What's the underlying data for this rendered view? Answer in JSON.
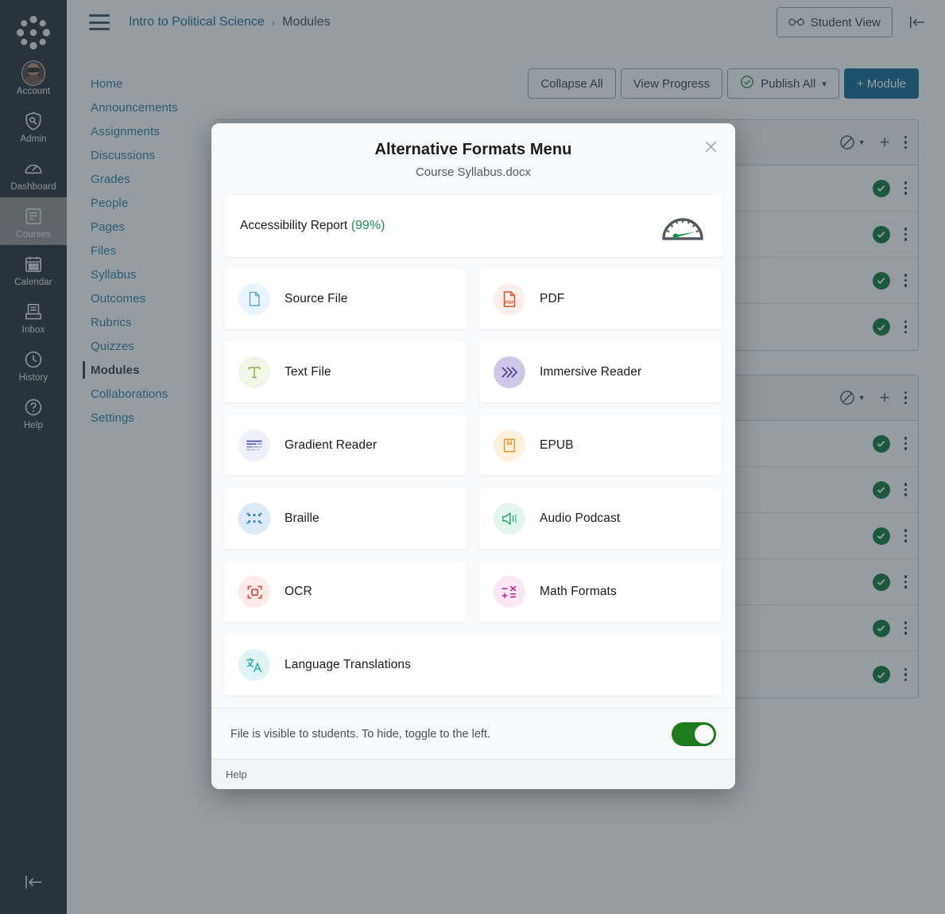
{
  "global_nav": {
    "logo_name": "canvas-logo",
    "items": [
      {
        "label": "Account",
        "icon": "avatar-icon",
        "active": false
      },
      {
        "label": "Admin",
        "icon": "shield-icon",
        "active": false
      },
      {
        "label": "Dashboard",
        "icon": "dashboard-icon",
        "active": false
      },
      {
        "label": "Courses",
        "icon": "courses-icon",
        "active": true
      },
      {
        "label": "Calendar",
        "icon": "calendar-icon",
        "active": false
      },
      {
        "label": "Inbox",
        "icon": "inbox-icon",
        "active": false
      },
      {
        "label": "History",
        "icon": "clock-icon",
        "active": false
      },
      {
        "label": "Help",
        "icon": "question-icon",
        "active": false
      }
    ],
    "collapse_icon": "collapse-left-icon"
  },
  "header": {
    "menu_icon": "hamburger-icon",
    "breadcrumb": {
      "course": "Intro to Political Science",
      "separator": "›",
      "current": "Modules"
    },
    "student_view_label": "Student View",
    "student_view_icon": "glasses-icon",
    "collapse_icon": "collapse-left-icon"
  },
  "course_nav": {
    "items": [
      {
        "label": "Home",
        "active": false
      },
      {
        "label": "Announcements",
        "active": false
      },
      {
        "label": "Assignments",
        "active": false
      },
      {
        "label": "Discussions",
        "active": false
      },
      {
        "label": "Grades",
        "active": false
      },
      {
        "label": "People",
        "active": false
      },
      {
        "label": "Pages",
        "active": false
      },
      {
        "label": "Files",
        "active": false
      },
      {
        "label": "Syllabus",
        "active": false
      },
      {
        "label": "Outcomes",
        "active": false
      },
      {
        "label": "Rubrics",
        "active": false
      },
      {
        "label": "Quizzes",
        "active": false
      },
      {
        "label": "Modules",
        "active": true
      },
      {
        "label": "Collaborations",
        "active": false
      },
      {
        "label": "Settings",
        "active": false
      }
    ]
  },
  "toolbar": {
    "collapse_all_label": "Collapse All",
    "view_progress_label": "View Progress",
    "publish_all_label": "Publish All",
    "publish_all_icon": "check-circle-icon",
    "publish_all_caret": "▾",
    "add_module_label": "+ Module"
  },
  "modules": [
    {
      "header_icons": {
        "unpublished": "no-entry-icon",
        "caret": "▾",
        "add": "+",
        "kebab": "kebab-icon"
      },
      "rows": [
        {
          "status": "published"
        },
        {
          "status": "published"
        },
        {
          "status": "published"
        },
        {
          "status": "published"
        }
      ]
    },
    {
      "header_icons": {
        "unpublished": "no-entry-icon",
        "caret": "▾",
        "add": "+",
        "kebab": "kebab-icon"
      },
      "rows": [
        {
          "status": "published"
        },
        {
          "status": "published"
        },
        {
          "status": "published"
        },
        {
          "status": "published"
        },
        {
          "status": "published"
        },
        {
          "status": "published"
        }
      ]
    }
  ],
  "modal": {
    "title": "Alternative Formats Menu",
    "subtitle": "Course Syllabus.docx",
    "close_icon": "close-icon",
    "accessibility": {
      "label": "Accessibility Report",
      "score": "(99%)",
      "score_color": "#17914c",
      "icon": "gauge-icon"
    },
    "formats": [
      {
        "label": "Source File",
        "icon": "document-icon",
        "icon_color": "#5aa9e0",
        "bg": "#eaf4fc",
        "full_width": false
      },
      {
        "label": "PDF",
        "icon": "pdf-icon",
        "icon_color": "#e8522b",
        "bg": "#fdeeea",
        "full_width": false
      },
      {
        "label": "Text File",
        "icon": "text-t-icon",
        "icon_color": "#8aa83a",
        "bg": "#f2f6e6",
        "full_width": false
      },
      {
        "label": "Immersive Reader",
        "icon": "chevrons-right-icon",
        "icon_color": "#4b3f8f",
        "bg": "#cfc6ea",
        "full_width": false
      },
      {
        "label": "Gradient Reader",
        "icon": "gradient-lines-icon",
        "icon_color": "#4a4fb0",
        "bg": "#eef0fa",
        "full_width": false
      },
      {
        "label": "EPUB",
        "icon": "book-bookmark-icon",
        "icon_color": "#e39a2c",
        "bg": "#fdf1de",
        "full_width": false
      },
      {
        "label": "Braille",
        "icon": "braille-dots-icon",
        "icon_color": "#2f7fc4",
        "bg": "#dceaf8",
        "full_width": false
      },
      {
        "label": "Audio Podcast",
        "icon": "speaker-icon",
        "icon_color": "#28a77c",
        "bg": "#e3f6ee",
        "full_width": false
      },
      {
        "label": "OCR",
        "icon": "scan-frame-icon",
        "icon_color": "#e0453a",
        "bg": "#fdeae9",
        "full_width": false
      },
      {
        "label": "Math Formats",
        "icon": "math-symbols-icon",
        "icon_color": "#b5269e",
        "bg": "#fbe6f6",
        "full_width": false
      },
      {
        "label": "Language Translations",
        "icon": "translate-icon",
        "icon_color": "#19a6a6",
        "bg": "#dff5f5",
        "full_width": true
      }
    ],
    "footer": {
      "visibility_text": "File is visible to students. To hide, toggle to the left.",
      "toggle_on": true,
      "toggle_color": "#1d7a1d",
      "help_label": "Help"
    }
  }
}
